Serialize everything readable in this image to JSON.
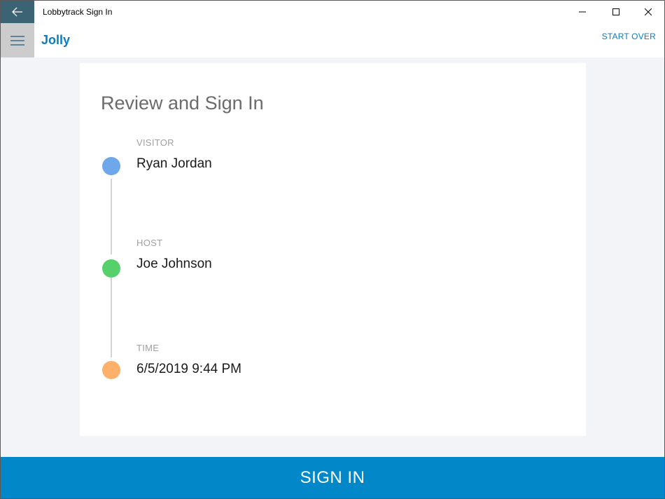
{
  "window": {
    "title": "Lobbytrack Sign In"
  },
  "header": {
    "app_title": "Jolly",
    "start_over_label": "START OVER"
  },
  "card": {
    "heading": "Review and Sign In",
    "steps": [
      {
        "label": "VISITOR",
        "value": "Ryan Jordan",
        "color": "#6fa8ea"
      },
      {
        "label": "HOST",
        "value": "Joe Johnson",
        "color": "#55d06b"
      },
      {
        "label": "TIME",
        "value": "6/5/2019 9:44 PM",
        "color": "#fdb06a"
      }
    ]
  },
  "footer": {
    "signin_label": "SIGN IN"
  },
  "colors": {
    "accent": "#0288c9",
    "titlebar_back": "#3c6374",
    "link": "#0a7cc1"
  },
  "icons": {
    "back": "arrow-left-icon",
    "menu": "hamburger-menu-icon",
    "minimize": "minimize-icon",
    "maximize": "maximize-icon",
    "close": "close-icon"
  }
}
